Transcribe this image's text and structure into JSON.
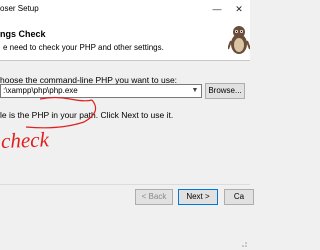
{
  "window": {
    "title": "oser Setup",
    "minimize_icon": "minimize-icon",
    "close_icon": "close-icon"
  },
  "header": {
    "title": "ngs Check",
    "subtitle": "e need to check your PHP and other settings.",
    "logo_icon": "composer-logo-icon"
  },
  "body": {
    "prompt": "hoose the command-line PHP you want to use:",
    "php_path": ":\\xampp\\php\\php.exe",
    "dropdown_icon": "chevron-down-icon",
    "browse_label": "Browse...",
    "path_note": "le is the PHP in your path. Click Next to use it."
  },
  "annotation": {
    "text": "check",
    "color": "#e02020"
  },
  "footer": {
    "back_label": "< Back",
    "next_label": "Next >",
    "cancel_label": "Ca"
  }
}
